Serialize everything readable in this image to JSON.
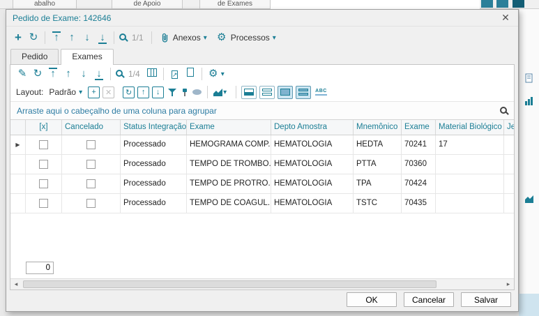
{
  "background": {
    "tab_partial": "abalho",
    "tab1": "de Apoio",
    "tab2": "de Exames"
  },
  "dialog": {
    "title": "Pedido de Exame: 142646"
  },
  "main_toolbar": {
    "pager": "1/1",
    "anexos": "Anexos",
    "processos": "Processos"
  },
  "tabs": {
    "pedido": "Pedido",
    "exames": "Exames"
  },
  "grid_toolbar": {
    "pager": "1/4",
    "layout_label": "Layout:",
    "layout_value": "Padrão"
  },
  "group_bar": "Arraste aqui o cabeçalho de uma coluna para agrupar",
  "grid": {
    "columns": {
      "check": "[x]",
      "cancelado": "Cancelado",
      "status": "Status Integração",
      "exame": "Exame",
      "depto": "Depto Amostra",
      "mnemonico": "Mnemônico",
      "exame_cod": "Exame",
      "material": "Material Biológico",
      "je": "Je"
    },
    "rows": [
      {
        "status": "Processado",
        "exame": "HEMOGRAMA COMP...",
        "depto": "HEMATOLOGIA",
        "mnemonico": "HEDTA",
        "codigo": "70241",
        "material": "17"
      },
      {
        "status": "Processado",
        "exame": "TEMPO DE TROMBO...",
        "depto": "HEMATOLOGIA",
        "mnemonico": "PTTA",
        "codigo": "70360",
        "material": ""
      },
      {
        "status": "Processado",
        "exame": "TEMPO DE PROTRO...",
        "depto": "HEMATOLOGIA",
        "mnemonico": "TPA",
        "codigo": "70424",
        "material": ""
      },
      {
        "status": "Processado",
        "exame": "TEMPO DE COAGUL...",
        "depto": "HEMATOLOGIA",
        "mnemonico": "TSTC",
        "codigo": "70435",
        "material": ""
      }
    ],
    "counter": "0"
  },
  "footer": {
    "ok": "OK",
    "cancel": "Cancelar",
    "save": "Salvar"
  },
  "icons": {
    "close": "✕",
    "plus": "+",
    "refresh": "↻",
    "arrow_up": "↑",
    "arrow_down": "↓",
    "dropdown": "▾",
    "pencil": "✎",
    "gear": "⚙",
    "row_arrow": "▶",
    "export_arrow": "↗",
    "scroll_left": "◂",
    "scroll_right": "▸",
    "abc": "ABC"
  },
  "colors": {
    "accent": "#1b7e95",
    "selected_toggle_bg": "#cde6f2"
  }
}
